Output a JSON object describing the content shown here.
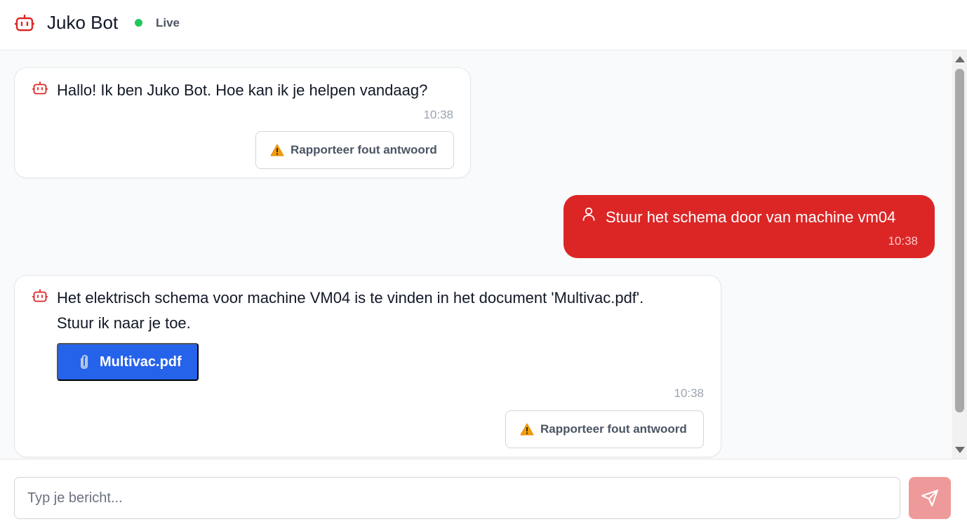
{
  "header": {
    "title": "Juko Bot",
    "status": "Live",
    "bot_icon": "robot-icon",
    "status_color": "#22c55e",
    "accent_color": "#dc2626"
  },
  "messages": [
    {
      "role": "bot",
      "icon": "robot-icon",
      "text": "Hallo! Ik ben Juko Bot. Hoe kan ik je helpen vandaag?",
      "time": "10:38",
      "report_label": "Rapporteer fout antwoord"
    },
    {
      "role": "user",
      "icon": "user-icon",
      "text": "Stuur het schema door van machine vm04",
      "time": "10:38"
    },
    {
      "role": "bot",
      "icon": "robot-icon",
      "text_line1": "Het elektrisch schema voor machine VM04 is te vinden in het document 'Multivac.pdf'.",
      "text_line2": "Stuur ik naar je toe.",
      "attachment": {
        "label": "Multivac.pdf",
        "icon": "paperclip-icon"
      },
      "time": "10:38",
      "report_label": "Rapporteer fout antwoord"
    }
  ],
  "composer": {
    "placeholder": "Typ je bericht...",
    "value": "",
    "send_icon": "send-icon"
  }
}
